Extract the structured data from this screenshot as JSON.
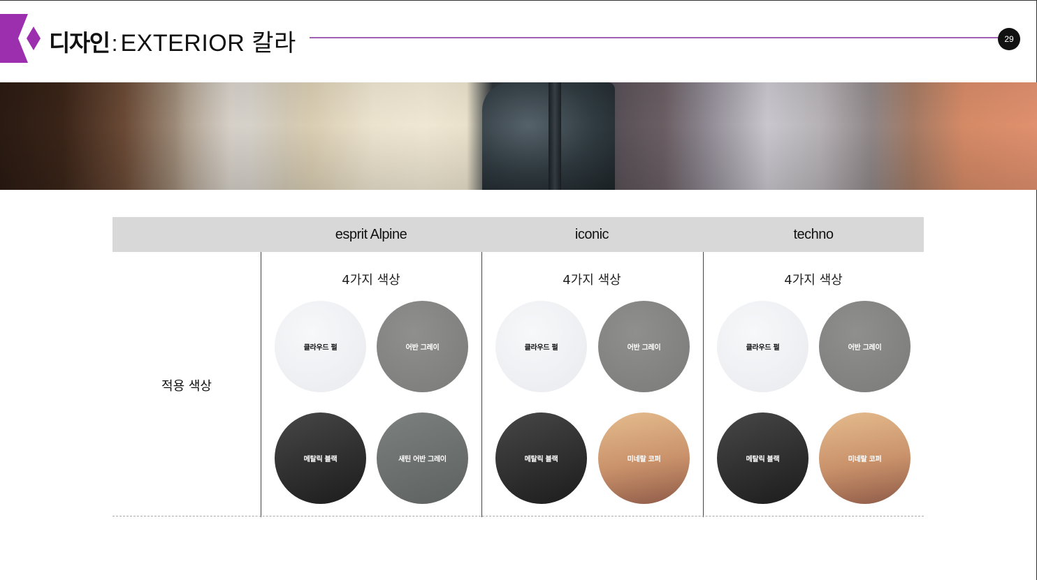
{
  "header": {
    "title_bold": "디자인",
    "title_colon": ":",
    "title_light": "EXTERIOR 칼라",
    "page_number": "29",
    "accent_color": "#9b2fae"
  },
  "banner": {
    "icon": "leather-color-samples-image"
  },
  "table": {
    "row_label": "적용 색상",
    "columns": [
      {
        "title": "esprit Alpine",
        "count_label": "4가지 색상",
        "swatches": [
          {
            "name": "클라우드 펄",
            "color": "#f1f2f4"
          },
          {
            "name": "어반 그레이",
            "color": "#858684"
          },
          {
            "name": "메탈릭 블랙",
            "color": "#2a2a2a"
          },
          {
            "name": "새틴 어반 그레이",
            "color": "#6c706e"
          }
        ]
      },
      {
        "title": "iconic",
        "count_label": "4가지 색상",
        "swatches": [
          {
            "name": "클라우드 펄",
            "color": "#f1f2f4"
          },
          {
            "name": "어반 그레이",
            "color": "#858684"
          },
          {
            "name": "메탈릭 블랙",
            "color": "#2a2a2a"
          },
          {
            "name": "미네랄 코퍼",
            "color": "#c58f68"
          }
        ]
      },
      {
        "title": "techno",
        "count_label": "4가지 색상",
        "swatches": [
          {
            "name": "클라우드 펄",
            "color": "#f1f2f4"
          },
          {
            "name": "어반 그레이",
            "color": "#858684"
          },
          {
            "name": "메탈릭 블랙",
            "color": "#2a2a2a"
          },
          {
            "name": "미네랄 코퍼",
            "color": "#c58f68"
          }
        ]
      }
    ]
  }
}
